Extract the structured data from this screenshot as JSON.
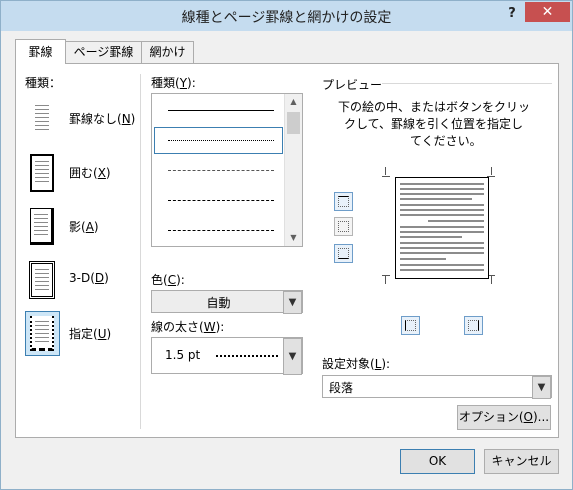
{
  "window": {
    "title": "線種とページ罫線と網かけの設定",
    "help": "?",
    "close": "✕"
  },
  "tabs": [
    "罫線",
    "ページ罫線",
    "網かけ"
  ],
  "setting": {
    "label": "種類：",
    "items": [
      {
        "text": "罫線なし(",
        "key": "N",
        "end": ")"
      },
      {
        "text": "囲む(",
        "key": "X",
        "end": ")"
      },
      {
        "text": "影(",
        "key": "A",
        "end": ")"
      },
      {
        "text": "3-D(",
        "key": "D",
        "end": ")"
      },
      {
        "text": "指定(",
        "key": "U",
        "end": ")"
      }
    ],
    "selected_index": 4
  },
  "style": {
    "label": "種類(",
    "key": "Y",
    "end": "):",
    "selected_index": 1
  },
  "color": {
    "label": "色(",
    "key": "C",
    "end": "):",
    "value": "自動"
  },
  "width": {
    "label": "線の太さ(",
    "key": "W",
    "end": "):",
    "value": "1.5 pt"
  },
  "preview": {
    "label": "プレビュー",
    "instruction": [
      "下の絵の中、またはボタンをクリッ",
      "クして、罫線を引く位置を指定し",
      "てください。"
    ]
  },
  "apply_to": {
    "label": "設定対象(",
    "key": "L",
    "end": "):",
    "value": "段落"
  },
  "buttons": {
    "options": {
      "text": "オプション(",
      "key": "O",
      "end": ")..."
    },
    "ok": "OK",
    "cancel": "キャンセル"
  },
  "colors": {
    "titlebar": "#c5dcef",
    "close": "#c75050",
    "selection": "#3c7fb1"
  }
}
